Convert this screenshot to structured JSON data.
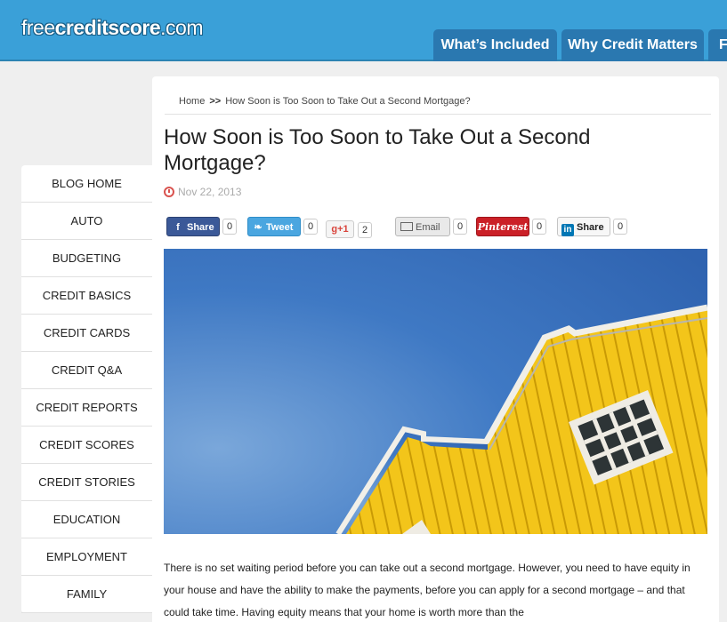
{
  "header": {
    "logo_thin": "free",
    "logo_bold": "creditscore",
    "logo_tld": ".com",
    "nav_tabs": [
      {
        "label": "What’s Included"
      },
      {
        "label": "Why Credit Matters"
      },
      {
        "label": "F"
      }
    ]
  },
  "breadcrumb": {
    "home": "Home",
    "separator": ">>",
    "current": "How Soon is Too Soon to Take Out a Second Mortgage?"
  },
  "article": {
    "title": "How Soon is Too Soon to Take Out a Second Mortgage?",
    "date": "Nov 22, 2013",
    "body": "There is no set waiting period before you can take out a second mortgage. However, you need to have equity in your house and have the ability to make the payments, before you can apply for a second mortgage – and that could take time. Having equity means that your home is worth more than the"
  },
  "share": {
    "facebook": {
      "label": "Share",
      "icon": "f",
      "count": "0"
    },
    "twitter": {
      "label": "Tweet",
      "icon": "❧",
      "count": "0"
    },
    "googleplus": {
      "label": "g+1",
      "count": "2"
    },
    "email": {
      "label": "Email",
      "count": "0"
    },
    "pinterest": {
      "label": "Pinterest",
      "count": "0"
    },
    "linkedin": {
      "label": "Share",
      "icon": "in",
      "count": "0"
    }
  },
  "sidebar": {
    "items": [
      {
        "label": "BLOG HOME"
      },
      {
        "label": "AUTO"
      },
      {
        "label": "BUDGETING"
      },
      {
        "label": "CREDIT BASICS"
      },
      {
        "label": "CREDIT CARDS"
      },
      {
        "label": "CREDIT Q&A"
      },
      {
        "label": "CREDIT REPORTS"
      },
      {
        "label": "CREDIT SCORES"
      },
      {
        "label": "CREDIT STORIES"
      },
      {
        "label": "EDUCATION"
      },
      {
        "label": "EMPLOYMENT"
      },
      {
        "label": "FAMILY"
      }
    ]
  },
  "colors": {
    "header": "#3aa0d8",
    "nav_tab": "#2a78b0",
    "date_icon": "#d9534f",
    "facebook": "#3b5998",
    "twitter": "#4aa6e0",
    "pinterest": "#cb2027",
    "linkedin": "#0077b5"
  }
}
